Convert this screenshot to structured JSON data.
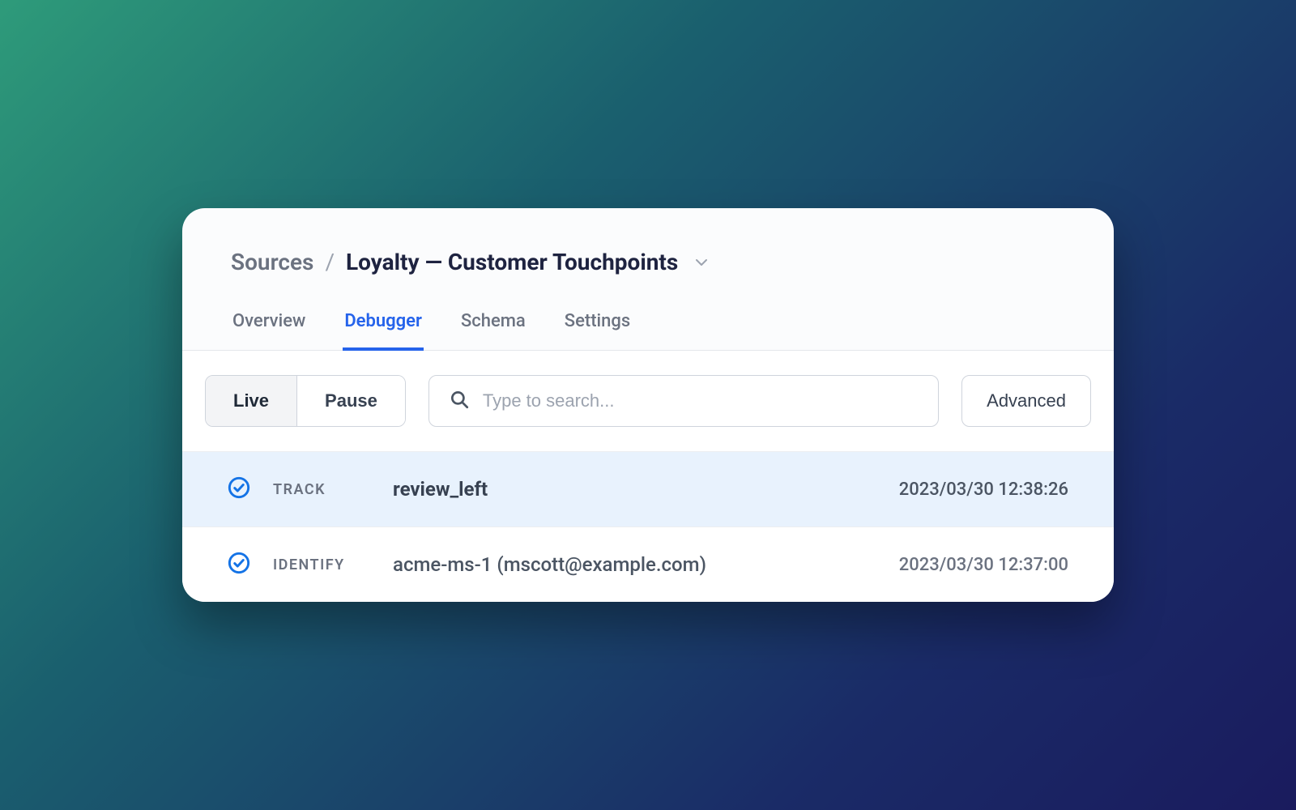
{
  "breadcrumb": {
    "root": "Sources",
    "separator": "/",
    "current": "Loyalty — Customer Touchpoints"
  },
  "tabs": [
    {
      "label": "Overview",
      "active": false
    },
    {
      "label": "Debugger",
      "active": true
    },
    {
      "label": "Schema",
      "active": false
    },
    {
      "label": "Settings",
      "active": false
    }
  ],
  "toolbar": {
    "segments": [
      {
        "label": "Live",
        "active": true
      },
      {
        "label": "Pause",
        "active": false
      }
    ],
    "search_placeholder": "Type to search...",
    "advanced_label": "Advanced"
  },
  "events": [
    {
      "type": "TRACK",
      "name": "review_left",
      "timestamp": "2023/03/30 12:38:26",
      "selected": true
    },
    {
      "type": "IDENTIFY",
      "name": "acme-ms-1 (mscott@example.com)",
      "timestamp": "2023/03/30 12:37:00",
      "selected": false
    }
  ],
  "colors": {
    "accent": "#2563eb",
    "icon_ring": "#1473e6"
  }
}
